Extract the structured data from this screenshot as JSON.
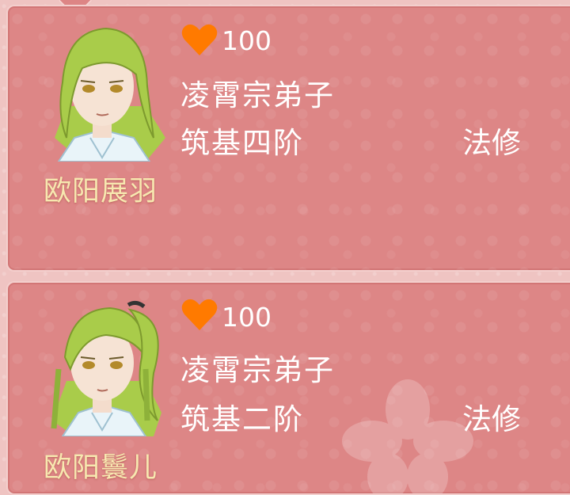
{
  "disciples": [
    {
      "name": "欧阳展羽",
      "affinity": "100",
      "faction": "凌霄宗弟子",
      "realm": "筑基四阶",
      "class": "法修",
      "hair_style": "long-straight"
    },
    {
      "name": "欧阳鬟儿",
      "affinity": "100",
      "faction": "凌霄宗弟子",
      "realm": "筑基二阶",
      "class": "法修",
      "hair_style": "ponytail-braids"
    }
  ],
  "colors": {
    "panel": "#dd8686",
    "panel_border": "#f3cfcd",
    "name_text": "#f7e8b0",
    "heart": "#ff7a00",
    "hair": "#a9cc4a"
  },
  "icons": {
    "affinity": "heart-icon"
  }
}
